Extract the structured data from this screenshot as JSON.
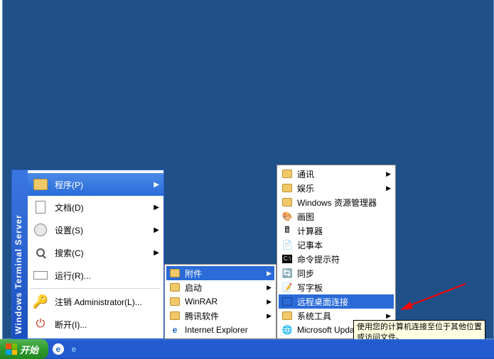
{
  "sideband": "Windows Terminal Server",
  "start": "开始",
  "startmenu": [
    {
      "label": "程序(P)",
      "icon": "folder",
      "arrow": true,
      "hover": true
    },
    {
      "label": "文档(D)",
      "icon": "doc",
      "arrow": true
    },
    {
      "label": "设置(S)",
      "icon": "gear",
      "arrow": true
    },
    {
      "label": "搜索(C)",
      "icon": "search",
      "arrow": true
    },
    {
      "label": "运行(R)...",
      "icon": "run"
    },
    {
      "sep": true
    },
    {
      "label": "注销 Administrator(L)...",
      "icon": "key"
    },
    {
      "label": "断开(I)...",
      "icon": "power"
    }
  ],
  "sub2": [
    {
      "label": "附件",
      "icon": "folder",
      "arrow": true,
      "hover": true
    },
    {
      "label": "启动",
      "icon": "folder",
      "arrow": true
    },
    {
      "label": "WinRAR",
      "icon": "folder",
      "arrow": true
    },
    {
      "label": "腾讯软件",
      "icon": "folder",
      "arrow": true
    },
    {
      "label": "Internet Explorer",
      "icon": "ie"
    }
  ],
  "sub3": [
    {
      "label": "通讯",
      "icon": "folder",
      "arrow": true
    },
    {
      "label": "娱乐",
      "icon": "folder",
      "arrow": true
    },
    {
      "label": "Windows 资源管理器",
      "icon": "folder"
    },
    {
      "label": "画图",
      "icon": "paint"
    },
    {
      "label": "计算器",
      "icon": "calc"
    },
    {
      "label": "记事本",
      "icon": "note"
    },
    {
      "label": "命令提示符",
      "icon": "cmd"
    },
    {
      "label": "同步",
      "icon": "sync"
    },
    {
      "label": "写字板",
      "icon": "wordpad"
    },
    {
      "label": "远程桌面连接",
      "icon": "rd",
      "hover": true
    },
    {
      "label": "系统工具",
      "icon": "folder",
      "arrow": true
    },
    {
      "label": "Microsoft Update",
      "icon": "update"
    }
  ],
  "tooltip": {
    "line1": "使用您的计算机连接至位于其他位置",
    "line2": "或访问文件。"
  },
  "tray": [
    "e",
    "e"
  ]
}
